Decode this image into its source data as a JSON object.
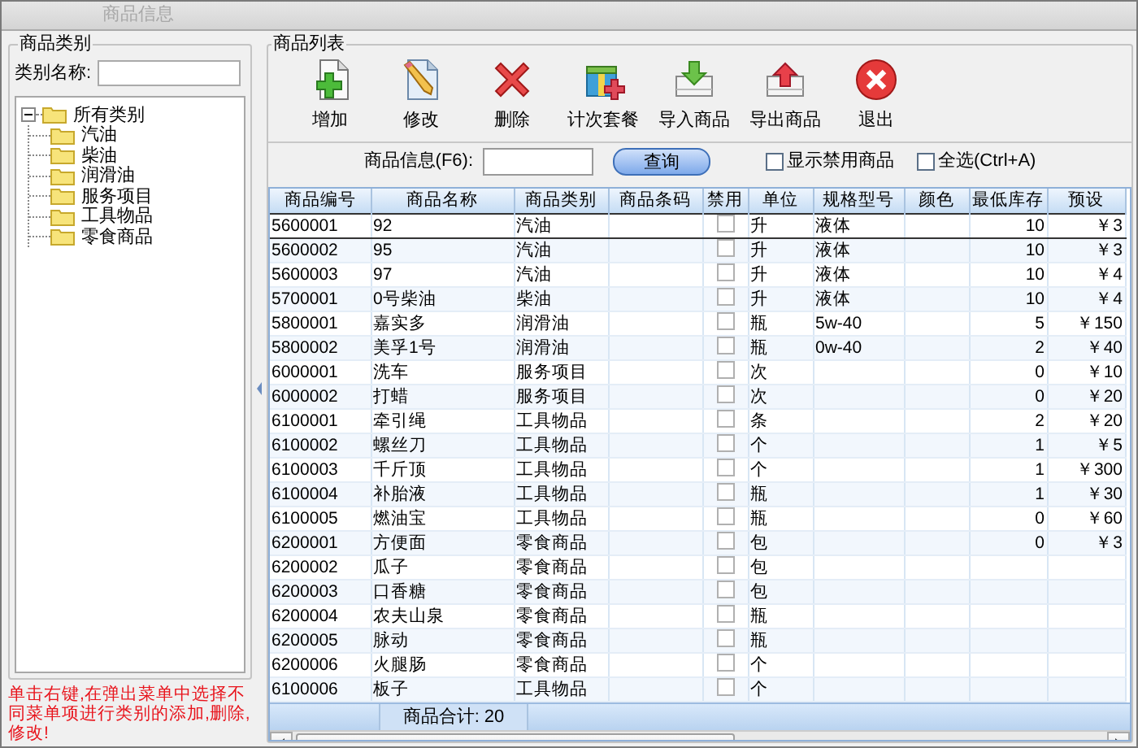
{
  "window": {
    "title": "商品信息"
  },
  "category_panel": {
    "title": "商品类别",
    "search_label": "类别名称:",
    "tree": {
      "label": "所有类别",
      "expanded": true,
      "children": [
        {
          "label": "汽油"
        },
        {
          "label": "柴油"
        },
        {
          "label": "润滑油"
        },
        {
          "label": "服务项目"
        },
        {
          "label": "工具物品"
        },
        {
          "label": "零食商品"
        }
      ]
    },
    "hint": "单击右键,在弹出菜单中选择不同菜单项进行类别的添加,删除,修改!"
  },
  "product_panel": {
    "title": "商品列表",
    "toolbar": [
      {
        "kind": "add",
        "label": "增加"
      },
      {
        "kind": "edit",
        "label": "修改"
      },
      {
        "kind": "delete",
        "label": "删除"
      },
      {
        "kind": "package",
        "label": "计次套餐"
      },
      {
        "kind": "import",
        "label": "导入商品"
      },
      {
        "kind": "export",
        "label": "导出商品"
      },
      {
        "kind": "exit",
        "label": "退出"
      }
    ],
    "search": {
      "label": "商品信息(F6):",
      "button": "查询",
      "options": [
        {
          "label": "显示禁用商品",
          "checked": false
        },
        {
          "label": "全选(Ctrl+A)",
          "checked": false
        }
      ]
    },
    "table": {
      "columns": [
        "商品编号",
        "商品名称",
        "商品类别",
        "商品条码",
        "禁用",
        "单位",
        "规格型号",
        "颜色",
        "最低库存",
        "预设"
      ],
      "rows": [
        {
          "code": "5600001",
          "name": "92",
          "category": "汽油",
          "disabled": false,
          "unit": "升",
          "spec": "液体",
          "min_stock": "10",
          "price": "￥3",
          "selected": true
        },
        {
          "code": "5600002",
          "name": "95",
          "category": "汽油",
          "disabled": false,
          "unit": "升",
          "spec": "液体",
          "min_stock": "10",
          "price": "￥3",
          "selected": false
        },
        {
          "code": "5600003",
          "name": "97",
          "category": "汽油",
          "disabled": false,
          "unit": "升",
          "spec": "液体",
          "min_stock": "10",
          "price": "￥4",
          "selected": false
        },
        {
          "code": "5700001",
          "name": "0号柴油",
          "category": "柴油",
          "disabled": false,
          "unit": "升",
          "spec": "液体",
          "min_stock": "10",
          "price": "￥4",
          "selected": false
        },
        {
          "code": "5800001",
          "name": "嘉实多",
          "category": "润滑油",
          "disabled": false,
          "unit": "瓶",
          "spec": "5w-40",
          "min_stock": "5",
          "price": "￥150",
          "selected": false
        },
        {
          "code": "5800002",
          "name": "美孚1号",
          "category": "润滑油",
          "disabled": false,
          "unit": "瓶",
          "spec": "0w-40",
          "min_stock": "2",
          "price": "￥40",
          "selected": false
        },
        {
          "code": "6000001",
          "name": "洗车",
          "category": "服务项目",
          "disabled": false,
          "unit": "次",
          "min_stock": "0",
          "price": "￥10",
          "selected": false
        },
        {
          "code": "6000002",
          "name": "打蜡",
          "category": "服务项目",
          "disabled": false,
          "unit": "次",
          "min_stock": "0",
          "price": "￥20",
          "selected": false
        },
        {
          "code": "6100001",
          "name": "牵引绳",
          "category": "工具物品",
          "disabled": false,
          "unit": "条",
          "min_stock": "2",
          "price": "￥20",
          "selected": false
        },
        {
          "code": "6100002",
          "name": "螺丝刀",
          "category": "工具物品",
          "disabled": false,
          "unit": "个",
          "min_stock": "1",
          "price": "￥5",
          "selected": false
        },
        {
          "code": "6100003",
          "name": "千斤顶",
          "category": "工具物品",
          "disabled": false,
          "unit": "个",
          "min_stock": "1",
          "price": "￥300",
          "selected": false
        },
        {
          "code": "6100004",
          "name": "补胎液",
          "category": "工具物品",
          "disabled": false,
          "unit": "瓶",
          "min_stock": "1",
          "price": "￥30",
          "selected": false
        },
        {
          "code": "6100005",
          "name": "燃油宝",
          "category": "工具物品",
          "disabled": false,
          "unit": "瓶",
          "min_stock": "0",
          "price": "￥60",
          "selected": false
        },
        {
          "code": "6200001",
          "name": "方便面",
          "category": "零食商品",
          "disabled": false,
          "unit": "包",
          "min_stock": "0",
          "price": "￥3",
          "selected": false
        },
        {
          "code": "6200002",
          "name": "瓜子",
          "category": "零食商品",
          "disabled": false,
          "unit": "包",
          "selected": false
        },
        {
          "code": "6200003",
          "name": "口香糖",
          "category": "零食商品",
          "disabled": false,
          "unit": "包",
          "selected": false
        },
        {
          "code": "6200004",
          "name": "农夫山泉",
          "category": "零食商品",
          "disabled": false,
          "unit": "瓶",
          "selected": false
        },
        {
          "code": "6200005",
          "name": "脉动",
          "category": "零食商品",
          "disabled": false,
          "unit": "瓶",
          "selected": false
        },
        {
          "code": "6200006",
          "name": "火腿肠",
          "category": "零食商品",
          "disabled": false,
          "unit": "个",
          "selected": false
        },
        {
          "code": "6100006",
          "name": "板子",
          "category": "工具物品",
          "disabled": false,
          "unit": "个",
          "selected": false
        }
      ]
    },
    "total": "商品合计: 20"
  }
}
